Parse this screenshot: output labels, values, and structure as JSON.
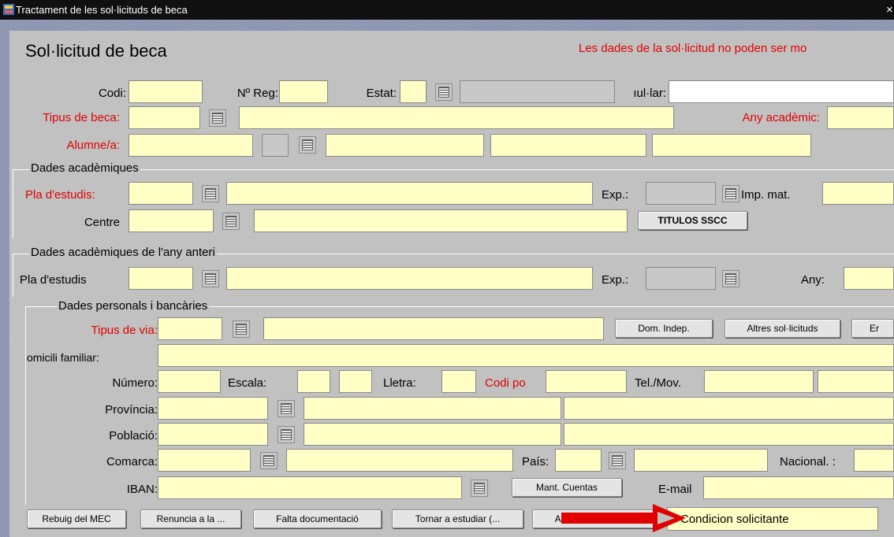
{
  "window": {
    "title": "Tractament de les sol·licituds de beca",
    "close": "×"
  },
  "header": {
    "title": "Sol·licitud de beca",
    "warning": "Les dades de la sol·licitud no poden ser mo"
  },
  "row1": {
    "codi": "Codi:",
    "nreg": "Nº Reg:",
    "estat": "Estat:",
    "titular": "ıul·lar:"
  },
  "row2": {
    "tipus": "Tipus de beca:",
    "any": "Any acadèmic:"
  },
  "row3": {
    "alumne": "Alumne/a:"
  },
  "acad": {
    "legend": "Dades acadèmiques",
    "pla": "Pla d'estudis:",
    "exp": "Exp.:",
    "imp": "Imp. mat.",
    "centre": "Centre",
    "titulos": "TITULOS SSCC"
  },
  "prev": {
    "legend": "Dades acadèmiques de l'any anteri",
    "pla": "Pla d'estudis",
    "exp": "Exp.:",
    "any": "Any:"
  },
  "pers": {
    "legend": "Dades personals i bancàries",
    "tipus_via": "Tipus de via:",
    "dom_indep": "Dom. Indep.",
    "altres": "Altres sol·licituds",
    "er": "Er",
    "domicili": "omicili familiar:",
    "numero": "Número:",
    "escala": "Escala:",
    "lletra": "Lletra:",
    "codi_po": "Codi po",
    "tel": "Tel./Mov.",
    "provincia": "Província:",
    "poblacio": "Població:",
    "comarca": "Comarca:",
    "pais": "País:",
    "nacional": "Nacional. :",
    "iban": "IBAN:",
    "mant": "Mant. Cuentas",
    "email": "E-mail"
  },
  "footer": {
    "rebuig": "Rebuig del MEC",
    "renuncia": "Renuncia a la ...",
    "falta": "Falta documentació",
    "tornar": "Tornar a estudiar (...",
    "adrica": "Adr ica durant el ...",
    "condicion": "Condicion solicitante"
  },
  "colors": {
    "field": "#ffffc6",
    "panel": "#c1c1c1",
    "required_label": "#e00000",
    "annotation_arrow": "#e00000"
  },
  "icons": [
    "forms-app-icon",
    "list-of-values-icon",
    "arrow-annotation-icon"
  ]
}
